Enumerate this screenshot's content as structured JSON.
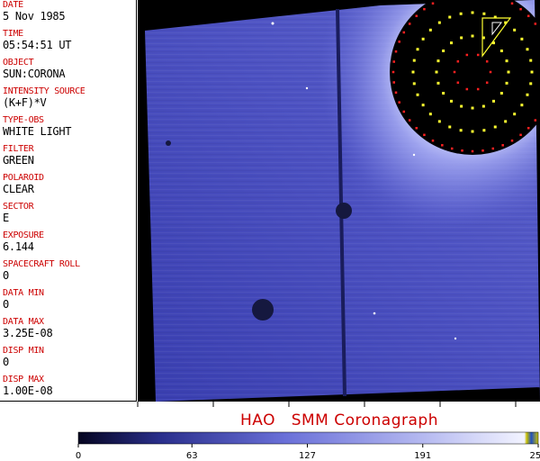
{
  "colors": {
    "label": "#cc0000",
    "value": "#000000",
    "title": "#cc0000",
    "disk": "#000000",
    "field_dark": "#2a2f95",
    "field_light": "#8c92e8",
    "grid_red": "#ff2020",
    "grid_yellow": "#ffff30"
  },
  "metadata": [
    {
      "label": "DATE",
      "value": "5 Nov 1985"
    },
    {
      "label": "TIME",
      "value": "05:54:51 UT"
    },
    {
      "label": "OBJECT",
      "value": "SUN:CORONA"
    },
    {
      "label": "INTENSITY SOURCE",
      "value": "(K+F)*V"
    },
    {
      "label": "TYPE-OBS",
      "value": "WHITE LIGHT"
    },
    {
      "label": "FILTER",
      "value": "GREEN"
    },
    {
      "label": "POLAROID",
      "value": "CLEAR"
    },
    {
      "label": "SECTOR",
      "value": "E"
    },
    {
      "label": "EXPOSURE",
      "value": "6.144"
    },
    {
      "label": "SPACECRAFT ROLL",
      "value": "0"
    },
    {
      "label": "DATA MIN",
      "value": "0"
    },
    {
      "label": "DATA MAX",
      "value": "3.25E-08"
    },
    {
      "label": "DISP MIN",
      "value": "0"
    },
    {
      "label": "DISP MAX",
      "value": "1.00E-08"
    }
  ],
  "title": "HAO   SMM Coronagraph",
  "colorbar": {
    "ticks": [
      "0",
      "63",
      "127",
      "191",
      "255"
    ],
    "tick_values": [
      0,
      63,
      127,
      191,
      255
    ],
    "min": 0,
    "max": 255
  }
}
